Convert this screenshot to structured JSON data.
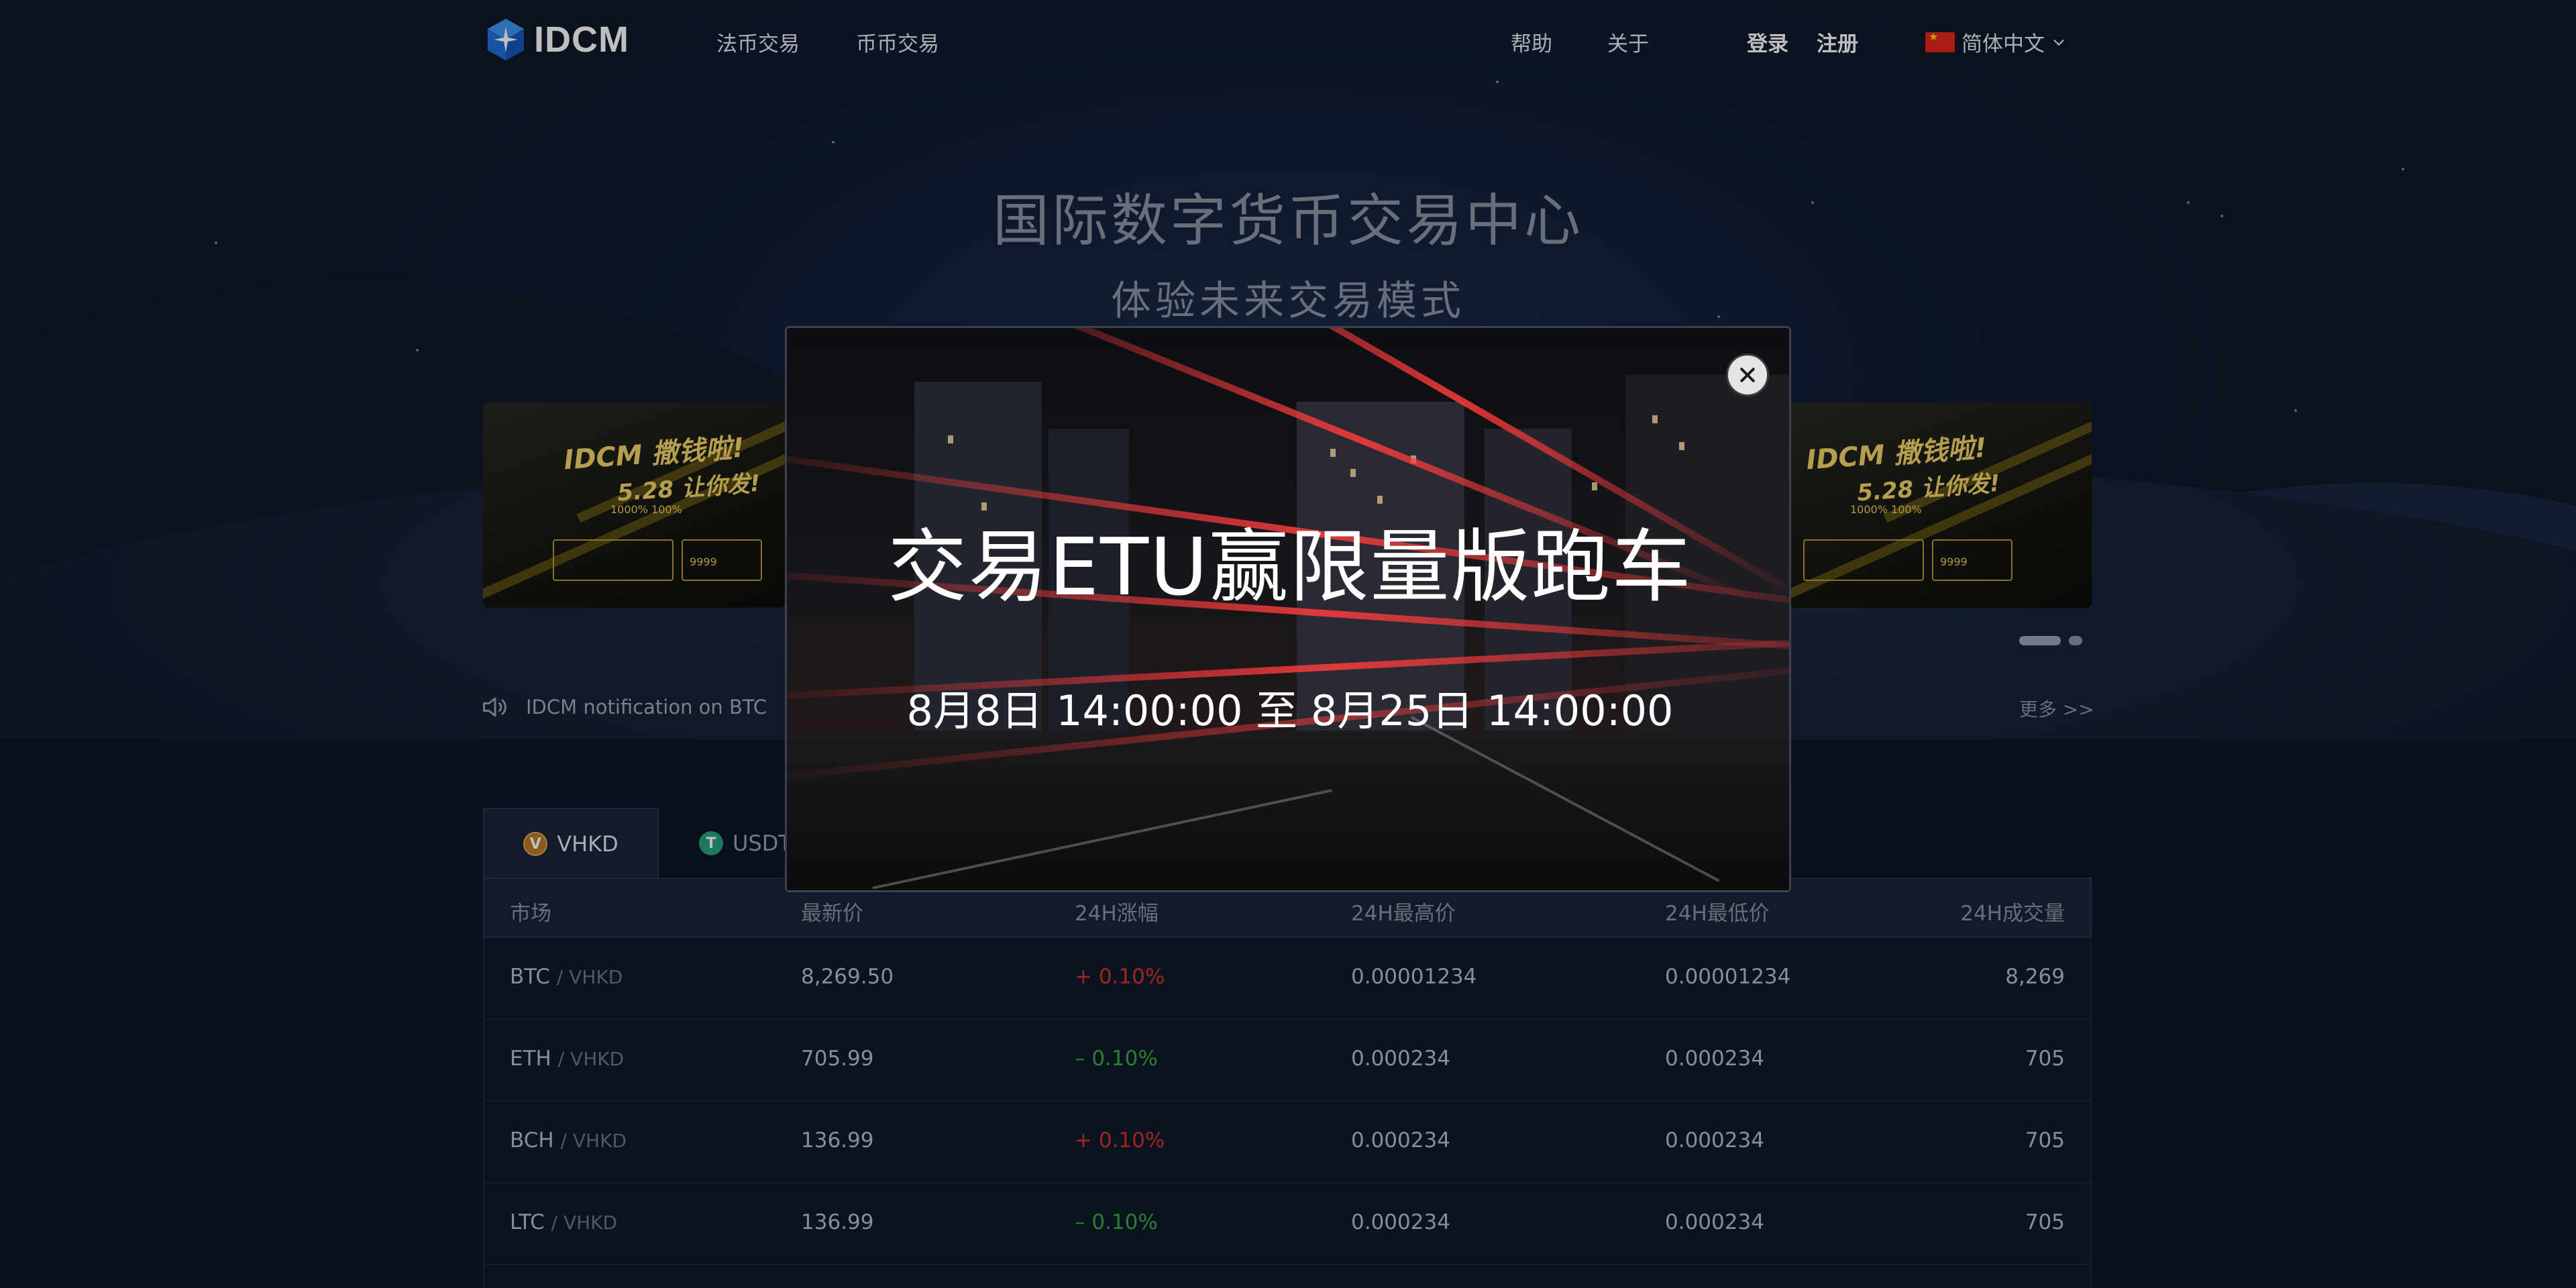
{
  "nav": {
    "logo_text": "IDCM",
    "links": [
      "法币交易",
      "币币交易"
    ],
    "help": "帮助",
    "about": "关于",
    "login": "登录",
    "register": "注册",
    "language": "简体中文"
  },
  "hero": {
    "title": "国际数字货币交易中心",
    "subtitle": "体验未来交易模式"
  },
  "banner": {
    "title": "IDCM 撒钱啦!",
    "subtitle": "5.28 让你发!",
    "line": "1000% 100%",
    "amount": "9999"
  },
  "notification": {
    "text": "IDCM notification on BTC",
    "more": "更多  >>"
  },
  "market": {
    "tabs": [
      {
        "icon": "V",
        "label": "VHKD"
      },
      {
        "icon": "T",
        "label": "USDT"
      }
    ],
    "columns": [
      "市场",
      "最新价",
      "24H涨幅",
      "24H最高价",
      "24H最低价",
      "24H成交量"
    ],
    "rows": [
      {
        "base": "BTC",
        "quote": "/ VHKD",
        "last": "8,269.50",
        "change": "+ 0.10%",
        "dir": "up",
        "high": "0.00001234",
        "low": "0.00001234",
        "volume": "8,269"
      },
      {
        "base": "ETH",
        "quote": "/ VHKD",
        "last": "705.99",
        "change": "– 0.10%",
        "dir": "down",
        "high": "0.000234",
        "low": "0.000234",
        "volume": "705"
      },
      {
        "base": "BCH",
        "quote": "/ VHKD",
        "last": "136.99",
        "change": "+ 0.10%",
        "dir": "up",
        "high": "0.000234",
        "low": "0.000234",
        "volume": "705"
      },
      {
        "base": "LTC",
        "quote": "/ VHKD",
        "last": "136.99",
        "change": "– 0.10%",
        "dir": "down",
        "high": "0.000234",
        "low": "0.000234",
        "volume": "705"
      }
    ]
  },
  "modal": {
    "title": "交易ETU赢限量版跑车",
    "date_range": "8月8日 14:00:00 至 8月25日 14:00:00"
  },
  "colors": {
    "background": "#0c1424",
    "up": "#d2352b",
    "down": "#3aa843",
    "accent_gold": "#f3d36a"
  },
  "icons": [
    "logo-mark-icon",
    "chevron-down-icon",
    "speaker-icon",
    "close-icon",
    "china-flag-icon"
  ]
}
